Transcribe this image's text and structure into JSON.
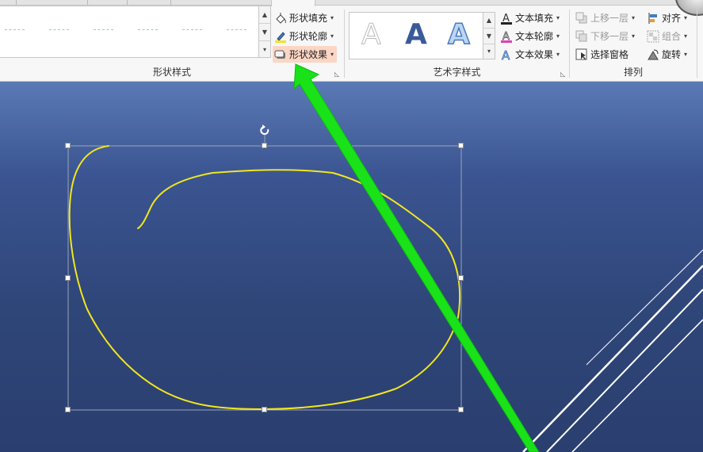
{
  "ribbon": {
    "shape_styles": {
      "group_label": "形状样式",
      "commands": {
        "fill": "形状填充",
        "outline": "形状轮廓",
        "effects": "形状效果"
      }
    },
    "wordart_styles": {
      "group_label": "艺术字样式",
      "letters": [
        "A",
        "A",
        "A"
      ],
      "commands": {
        "text_fill": "文本填充",
        "text_outline": "文本轮廓",
        "text_effects": "文本效果"
      }
    },
    "arrange": {
      "group_label": "排列",
      "commands": {
        "bring_forward": "上移一层",
        "send_backward": "下移一层",
        "selection_pane": "选择窗格",
        "align": "对齐",
        "group": "组合",
        "rotate": "旋转"
      }
    }
  },
  "colors": {
    "freeform_stroke": "#f2e51f",
    "arrow": "#19e219",
    "highlight": "#fbd6c4",
    "slide_top": "#5a7ab5",
    "slide_bottom": "#2a3f6f"
  }
}
